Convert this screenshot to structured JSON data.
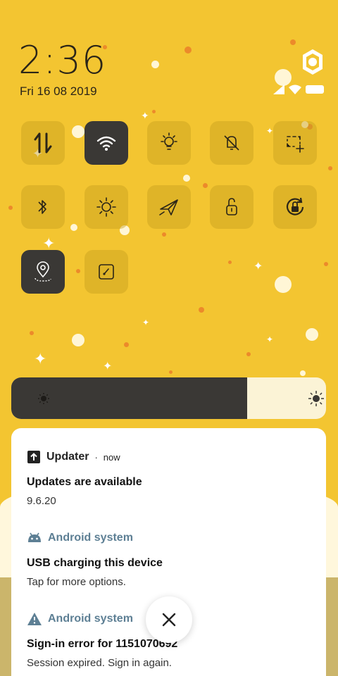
{
  "lockscreen": {
    "time": "2:36",
    "date": "Fri 16 08 2019"
  },
  "quick_tiles": [
    {
      "icon": "mobile-data-icon",
      "active": false
    },
    {
      "icon": "wifi-icon",
      "active": true
    },
    {
      "icon": "flashlight-icon",
      "active": false
    },
    {
      "icon": "sound-off-icon",
      "active": false
    },
    {
      "icon": "screenshot-icon",
      "active": false
    },
    {
      "icon": "bluetooth-icon",
      "active": false
    },
    {
      "icon": "auto-brightness-icon",
      "active": false
    },
    {
      "icon": "airplane-mode-icon",
      "active": false
    },
    {
      "icon": "unlock-icon",
      "active": false
    },
    {
      "icon": "rotation-lock-icon",
      "active": false
    },
    {
      "icon": "location-icon",
      "active": true
    },
    {
      "icon": "screen-recorder-icon",
      "active": false
    }
  ],
  "brightness": {
    "level": 0.75
  },
  "notifications": [
    {
      "app": "Updater",
      "time": "now",
      "title": "Updates are available",
      "text": "9.6.20"
    },
    {
      "app": "Android system",
      "title": "USB charging this device",
      "text": "Tap for more options."
    },
    {
      "app": "Android system",
      "title": "Sign-in error for 1151070692",
      "text": "Session expired. Sign in again."
    }
  ],
  "colors": {
    "accent": "#f3c531",
    "tile_active": "#3a3835",
    "app_label_blue": "#5d7f94"
  }
}
